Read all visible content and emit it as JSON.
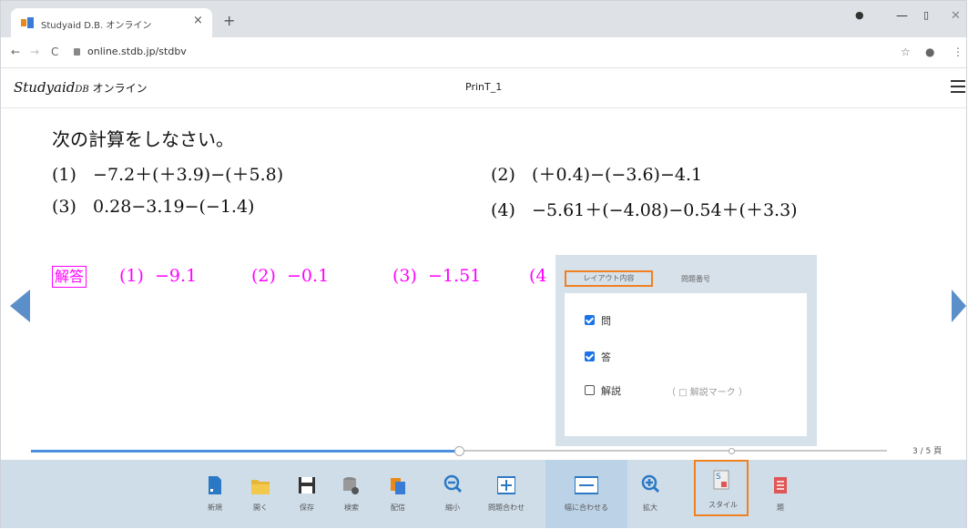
{
  "browser": {
    "tab_title": "Studyaid D.B. オンライン",
    "tab_close": "×",
    "new_tab": "+",
    "url": "online.stdb.jp/stdbv",
    "back": "←",
    "forward": "→",
    "reload": "C",
    "star": "☆",
    "account": "●",
    "more": "⋮",
    "minimize": "—",
    "maximize": "▯",
    "close": "✕",
    "record": "●"
  },
  "app": {
    "logo_main": "Studyaid",
    "logo_sup": "DB",
    "logo_suffix": " オンライン",
    "doc_title": "PrinT_1"
  },
  "question": {
    "title": "次の計算をしなさい。",
    "problems": [
      {
        "num": "(1)",
        "expr": "−7.2＋(＋3.9)−(＋5.8)"
      },
      {
        "num": "(2)",
        "expr": "(＋0.4)−(−3.6)−4.1"
      },
      {
        "num": "(3)",
        "expr": "0.28−3.19−(−1.4)"
      },
      {
        "num": "(4)",
        "expr": "−5.61＋(−4.08)−0.54＋(＋3.3)"
      }
    ]
  },
  "answer": {
    "label": "解答",
    "items": [
      {
        "num": "(1)",
        "value": "−9.1"
      },
      {
        "num": "(2)",
        "value": "−0.1"
      },
      {
        "num": "(3)",
        "value": "−1.51"
      },
      {
        "num": "(4",
        "value": ""
      }
    ]
  },
  "popup": {
    "tabs": [
      "レイアウト内容",
      "問題番号"
    ],
    "options": [
      {
        "label": "問",
        "checked": true
      },
      {
        "label": "答",
        "checked": true
      },
      {
        "label": "解説",
        "checked": false
      }
    ],
    "sub_option": "（ □ 解説マーク ）"
  },
  "pager": {
    "current": 3,
    "total": 5,
    "text": "3 / 5 頁",
    "progress": 0.5
  },
  "toolbar": {
    "items": [
      {
        "label": "新規",
        "icon": "new-doc-icon"
      },
      {
        "label": "開く",
        "icon": "folder-icon"
      },
      {
        "label": "保存",
        "icon": "save-icon"
      },
      {
        "label": "検索",
        "icon": "search-db-icon"
      },
      {
        "label": "配信",
        "icon": "distribute-icon"
      },
      {
        "label": "縮小",
        "icon": "zoom-out-icon"
      },
      {
        "label": "問題合わせ",
        "icon": "fit-problem-icon"
      },
      {
        "label": "幅に合わせる",
        "icon": "fit-width-icon"
      },
      {
        "label": "拡大",
        "icon": "zoom-in-icon"
      },
      {
        "label": "スタイル",
        "icon": "style-icon"
      },
      {
        "label": "題",
        "icon": "list-icon"
      }
    ]
  },
  "colors": {
    "answer": "#ff00ff",
    "accent": "#1a73e8",
    "highlight": "#f08020",
    "toolbar_bg": "#cfdde9"
  }
}
